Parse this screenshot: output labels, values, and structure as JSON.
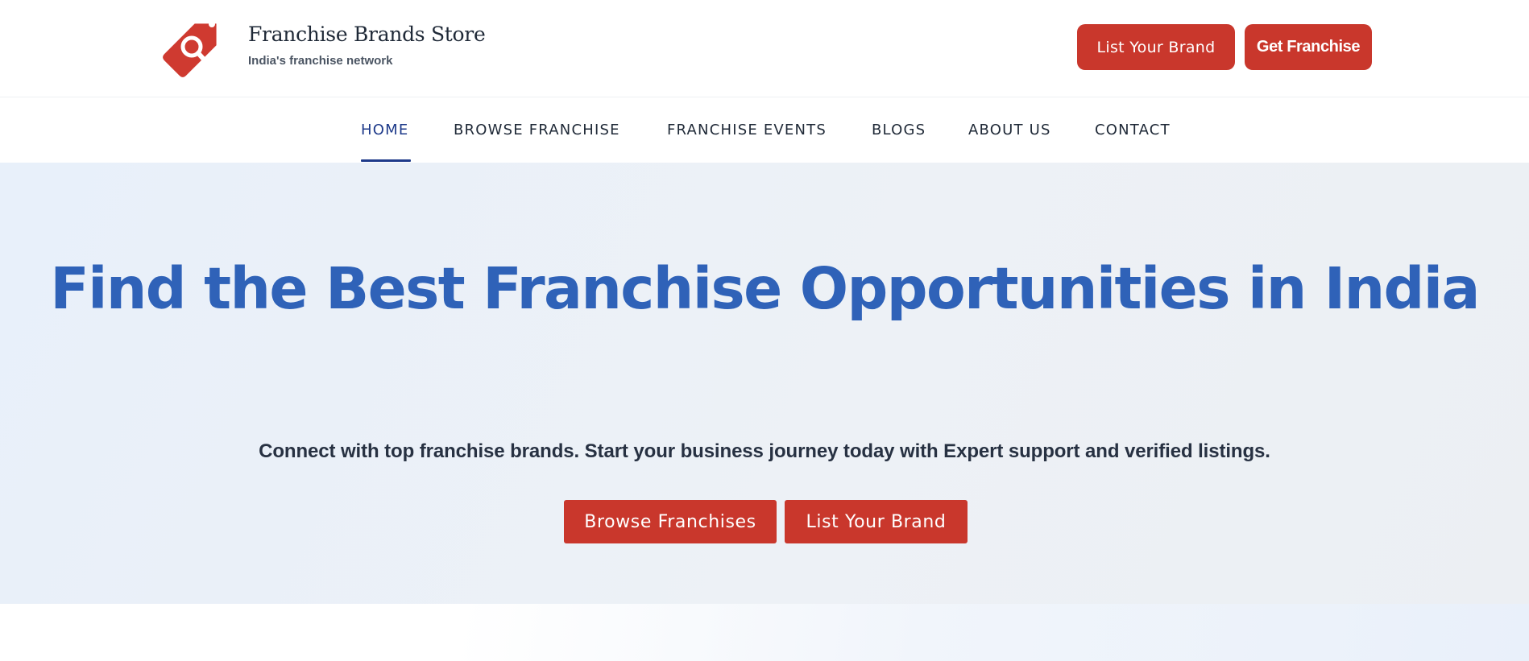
{
  "header": {
    "logo_icon": "price-tag-search-icon",
    "brand_name": "Franchise Brands Store",
    "tagline": "India's franchise network",
    "list_brand_label": "List Your Brand",
    "get_franchise_label": "Get Franchise"
  },
  "nav": {
    "items": [
      {
        "label": "HOME",
        "active": true
      },
      {
        "label": "BROWSE FRANCHISE",
        "active": false
      },
      {
        "label": "FRANCHISE EVENTS",
        "active": false
      },
      {
        "label": "BLOGS",
        "active": false
      },
      {
        "label": "ABOUT US",
        "active": false
      },
      {
        "label": "CONTACT",
        "active": false
      }
    ]
  },
  "hero": {
    "title": "Find the Best Franchise Opportunities in India",
    "subtitle": "Connect with top franchise brands. Start your business journey today with Expert support and verified listings.",
    "browse_label": "Browse Franchises",
    "list_label": "List Your Brand"
  },
  "colors": {
    "accent": "#c9372c",
    "title_blue": "#2f62b8",
    "nav_active": "#1e3a8a",
    "hero_bg": "#ebf1f8"
  }
}
